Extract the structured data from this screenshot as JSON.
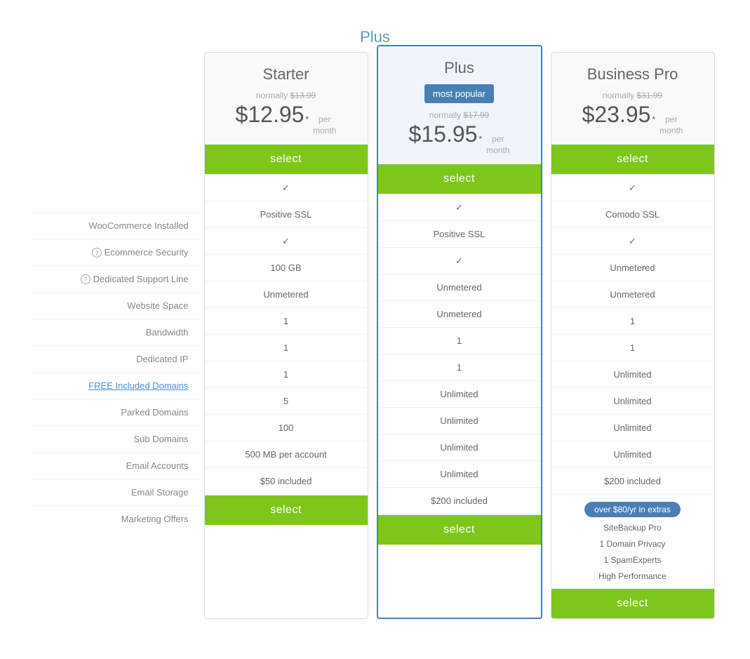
{
  "plus_label": "Plus",
  "plans": [
    {
      "id": "starter",
      "name": "Starter",
      "featured": false,
      "badge": null,
      "normally": "normally",
      "original_price": "$13.99",
      "price": "$12.95",
      "per": "per\nmonth",
      "select_label": "select",
      "woocommerce": "✓",
      "ecommerce_security": "Positive SSL",
      "dedicated_support": "✓",
      "website_space": "100 GB",
      "bandwidth": "Unmetered",
      "dedicated_ip": "1",
      "included_domains": "1",
      "parked_domains": "1",
      "sub_domains": "5",
      "email_accounts": "100",
      "email_storage": "500 MB per account",
      "marketing_offers": "$50 included",
      "extras": null
    },
    {
      "id": "plus",
      "name": "Plus",
      "featured": true,
      "badge": "most popular",
      "normally": "normally",
      "original_price": "$17.99",
      "price": "$15.95",
      "per": "per\nmonth",
      "select_label": "select",
      "woocommerce": "✓",
      "ecommerce_security": "Positive SSL",
      "dedicated_support": "✓",
      "website_space": "Unmetered",
      "bandwidth": "Unmetered",
      "dedicated_ip": "1",
      "included_domains": "1",
      "parked_domains": "Unlimited",
      "sub_domains": "Unlimited",
      "email_accounts": "Unlimited",
      "email_storage": "Unlimited",
      "marketing_offers": "$200 included",
      "extras": null
    },
    {
      "id": "business-pro",
      "name": "Business Pro",
      "featured": false,
      "badge": null,
      "normally": "normally",
      "original_price": "$31.99",
      "price": "$23.95",
      "per": "per\nmonth",
      "select_label": "select",
      "woocommerce": "✓",
      "ecommerce_security": "Comodo SSL",
      "dedicated_support": "✓",
      "website_space": "Unmetered",
      "bandwidth": "Unmetered",
      "dedicated_ip": "1",
      "included_domains": "1",
      "parked_domains": "Unlimited",
      "sub_domains": "Unlimited",
      "email_accounts": "Unlimited",
      "email_storage": "Unlimited",
      "marketing_offers": "$200 included",
      "extras": {
        "badge": "over $80/yr in extras",
        "items": [
          "SiteBackup Pro",
          "1 Domain Privacy",
          "1 SpamExperts",
          "High Performance"
        ]
      }
    }
  ],
  "labels": [
    {
      "text": "WooCommerce Installed",
      "help": false,
      "link": false
    },
    {
      "text": "Ecommerce Security",
      "help": true,
      "link": false
    },
    {
      "text": "Dedicated Support Line",
      "help": true,
      "link": false
    },
    {
      "text": "Website Space",
      "help": false,
      "link": false
    },
    {
      "text": "Bandwidth",
      "help": false,
      "link": false
    },
    {
      "text": "Dedicated IP",
      "help": false,
      "link": false
    },
    {
      "text": "FREE Included Domains",
      "help": false,
      "link": true
    },
    {
      "text": "Parked Domains",
      "help": false,
      "link": false
    },
    {
      "text": "Sub Domains",
      "help": false,
      "link": false
    },
    {
      "text": "Email Accounts",
      "help": false,
      "link": false
    },
    {
      "text": "Email Storage",
      "help": false,
      "link": false
    },
    {
      "text": "Marketing Offers",
      "help": false,
      "link": false
    }
  ],
  "cell_keys": [
    "woocommerce",
    "ecommerce_security",
    "dedicated_support",
    "website_space",
    "bandwidth",
    "dedicated_ip",
    "included_domains",
    "parked_domains",
    "sub_domains",
    "email_accounts",
    "email_storage",
    "marketing_offers"
  ]
}
